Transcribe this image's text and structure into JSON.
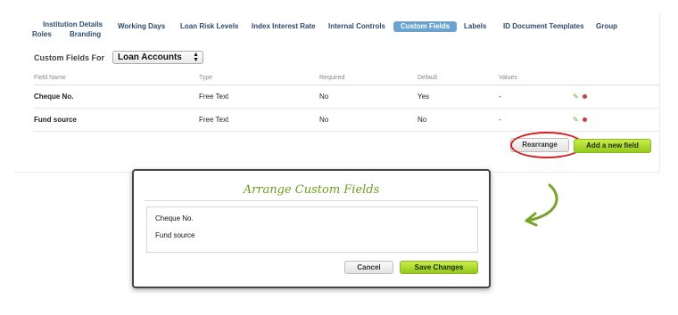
{
  "tabs": [
    {
      "label": "Institution Details"
    },
    {
      "label": "Working Days"
    },
    {
      "label": "Loan Risk Levels"
    },
    {
      "label": "Index Interest Rate"
    },
    {
      "label": "Internal Controls"
    },
    {
      "label": "Custom Fields",
      "active": true
    },
    {
      "label": "Labels"
    },
    {
      "label": "ID Document Templates"
    },
    {
      "label": "Group"
    },
    {
      "label": "Roles"
    },
    {
      "label": "Branding"
    }
  ],
  "custom_fields_for": {
    "label": "Custom Fields For",
    "selected": "Loan Accounts"
  },
  "table": {
    "headers": [
      "Field Name",
      "Type",
      "Required",
      "Default",
      "Values"
    ],
    "rows": [
      {
        "name": "Cheque No.",
        "type": "Free Text",
        "required": "No",
        "default": "Yes",
        "values": "-"
      },
      {
        "name": "Fund source",
        "type": "Free Text",
        "required": "No",
        "default": "No",
        "values": "-"
      }
    ]
  },
  "buttons": {
    "rearrange": "Rearrange",
    "add_field": "Add a new field"
  },
  "dialog": {
    "title": "Arrange Custom Fields",
    "items": [
      "Cheque No.",
      "Fund source"
    ],
    "cancel": "Cancel",
    "save": "Save Changes"
  },
  "colors": {
    "tab_active": "#6aa3cf",
    "accent_green": "#94c81c",
    "highlight_red": "#d42020",
    "title_green": "#6f9b21"
  },
  "icons": [
    "pencil-icon",
    "delete-dot-icon",
    "curved-arrow-icon"
  ]
}
